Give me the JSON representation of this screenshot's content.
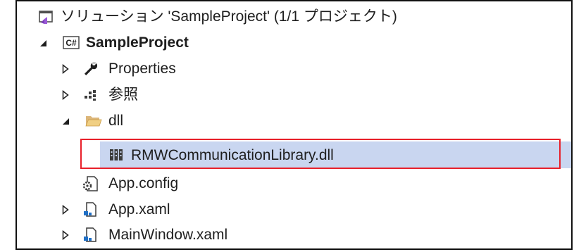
{
  "solution_explorer": {
    "solution_label": "ソリューション 'SampleProject' (1/1 プロジェクト)",
    "project": {
      "badge": "C#",
      "name": "SampleProject",
      "expanded": true
    },
    "items": [
      {
        "label": "Properties",
        "icon": "wrench-icon",
        "expander": "collapsed"
      },
      {
        "label": "参照",
        "icon": "references-icon",
        "expander": "collapsed"
      },
      {
        "label": "dll",
        "icon": "folder-icon",
        "expander": "expanded"
      },
      {
        "label": "RMWCommunicationLibrary.dll",
        "icon": "library-icon",
        "expander": "none",
        "selected": true
      },
      {
        "label": "App.config",
        "icon": "config-file-icon",
        "expander": "none"
      },
      {
        "label": "App.xaml",
        "icon": "xaml-file-icon",
        "expander": "collapsed"
      },
      {
        "label": "MainWindow.xaml",
        "icon": "xaml-file-icon",
        "expander": "collapsed"
      }
    ],
    "colors": {
      "selection_background": "#c9d6f0",
      "highlight_border": "#e8202a",
      "frame_border": "#111111"
    }
  }
}
